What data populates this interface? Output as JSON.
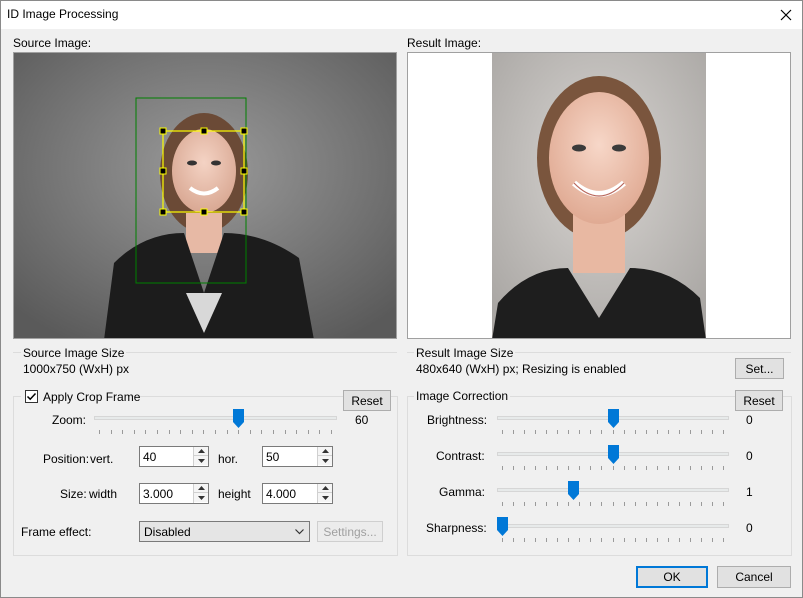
{
  "window": {
    "title": "ID Image Processing"
  },
  "source": {
    "label": "Source Image:"
  },
  "result": {
    "label": "Result Image:"
  },
  "source_size": {
    "title": "Source Image Size",
    "value": "1000x750 (WxH) px"
  },
  "result_size": {
    "title": "Result Image Size",
    "value": "480x640 (WxH) px; Resizing is enabled",
    "set_label": "Set..."
  },
  "crop": {
    "checkbox_label": "Apply Crop Frame",
    "checked": true,
    "reset_label": "Reset",
    "zoom_label": "Zoom:",
    "zoom_value": "60",
    "zoom_fraction": 0.6,
    "position_label": "Position:",
    "vert_label": "vert.",
    "vert_value": "40",
    "hor_label": "hor.",
    "hor_value": "50",
    "size_label": "Size:",
    "width_label": "width",
    "width_value": "3.000",
    "height_label": "height",
    "height_value": "4.000",
    "frame_effect_label": "Frame effect:",
    "frame_effect_value": "Disabled",
    "settings_label": "Settings..."
  },
  "correction": {
    "title": "Image Correction",
    "reset_label": "Reset",
    "rows": [
      {
        "label": "Brightness:",
        "value": "0",
        "fraction": 0.5
      },
      {
        "label": "Contrast:",
        "value": "0",
        "fraction": 0.5
      },
      {
        "label": "Gamma:",
        "value": "1",
        "fraction": 0.32
      },
      {
        "label": "Sharpness:",
        "value": "0",
        "fraction": 0.0
      }
    ]
  },
  "footer": {
    "ok_label": "OK",
    "cancel_label": "Cancel"
  },
  "colors": {
    "accent": "#0078d7",
    "crop_frame": "#ffff00",
    "face_frame": "#008000"
  }
}
